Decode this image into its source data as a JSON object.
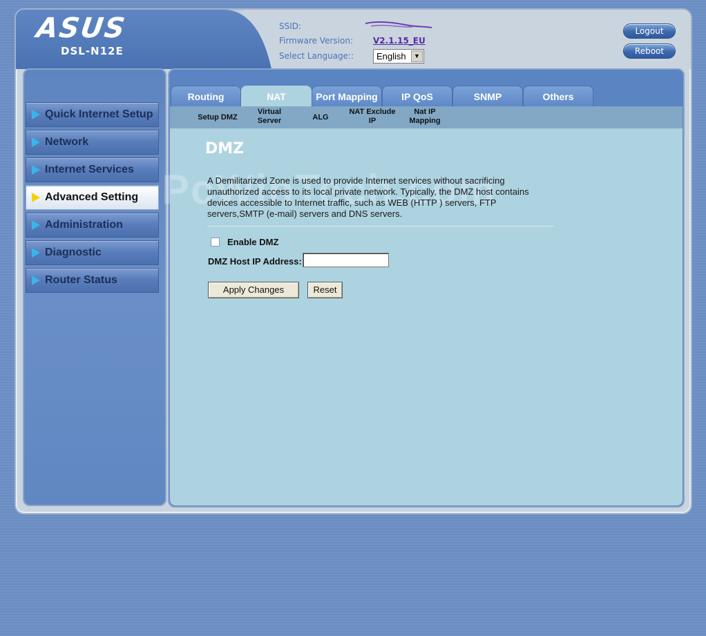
{
  "header": {
    "logo": "ASUS",
    "model": "DSL-N12E",
    "ssid_label": "SSID:",
    "firmware_label": "Firmware Version:",
    "firmware_value": "V2.1.15_EU",
    "language_label": "Select Language::",
    "language_value": "English",
    "logout_label": "Logout",
    "reboot_label": "Reboot"
  },
  "sidebar": {
    "items": [
      {
        "label": "Quick Internet Setup"
      },
      {
        "label": "Network"
      },
      {
        "label": "Internet Services"
      },
      {
        "label": "Advanced Setting"
      },
      {
        "label": "Administration"
      },
      {
        "label": "Diagnostic"
      },
      {
        "label": "Router Status"
      }
    ],
    "active_index": 3
  },
  "tabs": [
    {
      "label": "Routing"
    },
    {
      "label": "NAT"
    },
    {
      "label": "Port Mapping"
    },
    {
      "label": "IP QoS"
    },
    {
      "label": "SNMP"
    },
    {
      "label": "Others"
    }
  ],
  "subtabs": [
    {
      "line1": "Setup DMZ",
      "line2": ""
    },
    {
      "line1": "Virtual",
      "line2": "Server"
    },
    {
      "line1": "ALG",
      "line2": ""
    },
    {
      "line1": "NAT Exclude",
      "line2": "IP"
    },
    {
      "line1": "Nat IP",
      "line2": "Mapping"
    }
  ],
  "watermark": "PcWinTech.com",
  "main": {
    "title": "DMZ",
    "description": "A Demilitarized Zone is used to provide Internet services without sacrificing unauthorized access to its local private network. Typically, the DMZ host contains devices accessible to Internet traffic, such as WEB (HTTP ) servers, FTP servers,SMTP (e-mail) servers and DNS servers.",
    "enable_label": "Enable DMZ",
    "enable_checked": false,
    "ip_label": "DMZ Host IP Address:",
    "ip_value": "",
    "apply_label": "Apply Changes",
    "reset_label": "Reset"
  },
  "colors": {
    "accent": "#5a84c2",
    "content_bg": "#aed3e0",
    "active_arrow": "#f4d20a",
    "menu_arrow": "#39b6e8",
    "firmware_link": "#5a2ba0"
  }
}
